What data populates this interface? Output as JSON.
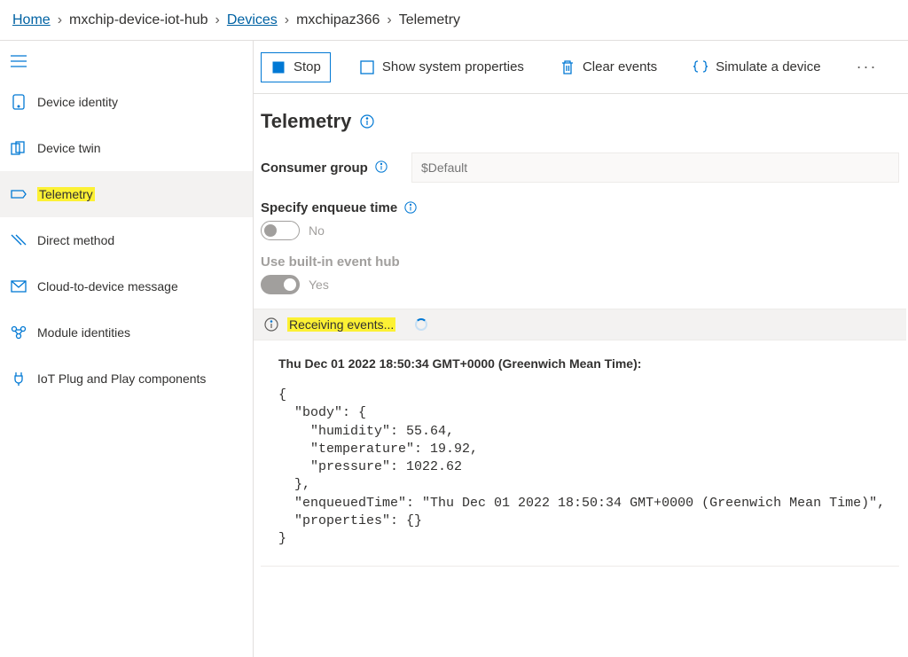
{
  "breadcrumb": {
    "home": "Home",
    "hub": "mxchip-device-iot-hub",
    "devices": "Devices",
    "device": "mxchipaz366",
    "page": "Telemetry"
  },
  "sidebar": {
    "items": [
      {
        "label": "Device identity",
        "icon": "device-identity-icon"
      },
      {
        "label": "Device twin",
        "icon": "device-twin-icon"
      },
      {
        "label": "Telemetry",
        "icon": "telemetry-icon",
        "selected": true,
        "highlight": true
      },
      {
        "label": "Direct method",
        "icon": "direct-method-icon"
      },
      {
        "label": "Cloud-to-device message",
        "icon": "mail-icon"
      },
      {
        "label": "Module identities",
        "icon": "module-identities-icon"
      },
      {
        "label": "IoT Plug and Play components",
        "icon": "plug-play-icon"
      }
    ]
  },
  "toolbar": {
    "stop": "Stop",
    "show_system_properties": "Show system properties",
    "clear_events": "Clear events",
    "simulate_device": "Simulate a device"
  },
  "page": {
    "title": "Telemetry",
    "consumer_group_label": "Consumer group",
    "consumer_group_placeholder": "$Default",
    "specify_enqueue_label": "Specify enqueue time",
    "specify_enqueue_value": "No",
    "use_builtin_label": "Use built-in event hub",
    "use_builtin_value": "Yes",
    "status_text": "Receiving events..."
  },
  "event": {
    "timestamp_label": "Thu Dec 01 2022 18:50:34 GMT+0000 (Greenwich Mean Time):",
    "json_text": "{\n  \"body\": {\n    \"humidity\": 55.64,\n    \"temperature\": 19.92,\n    \"pressure\": 1022.62\n  },\n  \"enqueuedTime\": \"Thu Dec 01 2022 18:50:34 GMT+0000 (Greenwich Mean Time)\",\n  \"properties\": {}\n}"
  }
}
